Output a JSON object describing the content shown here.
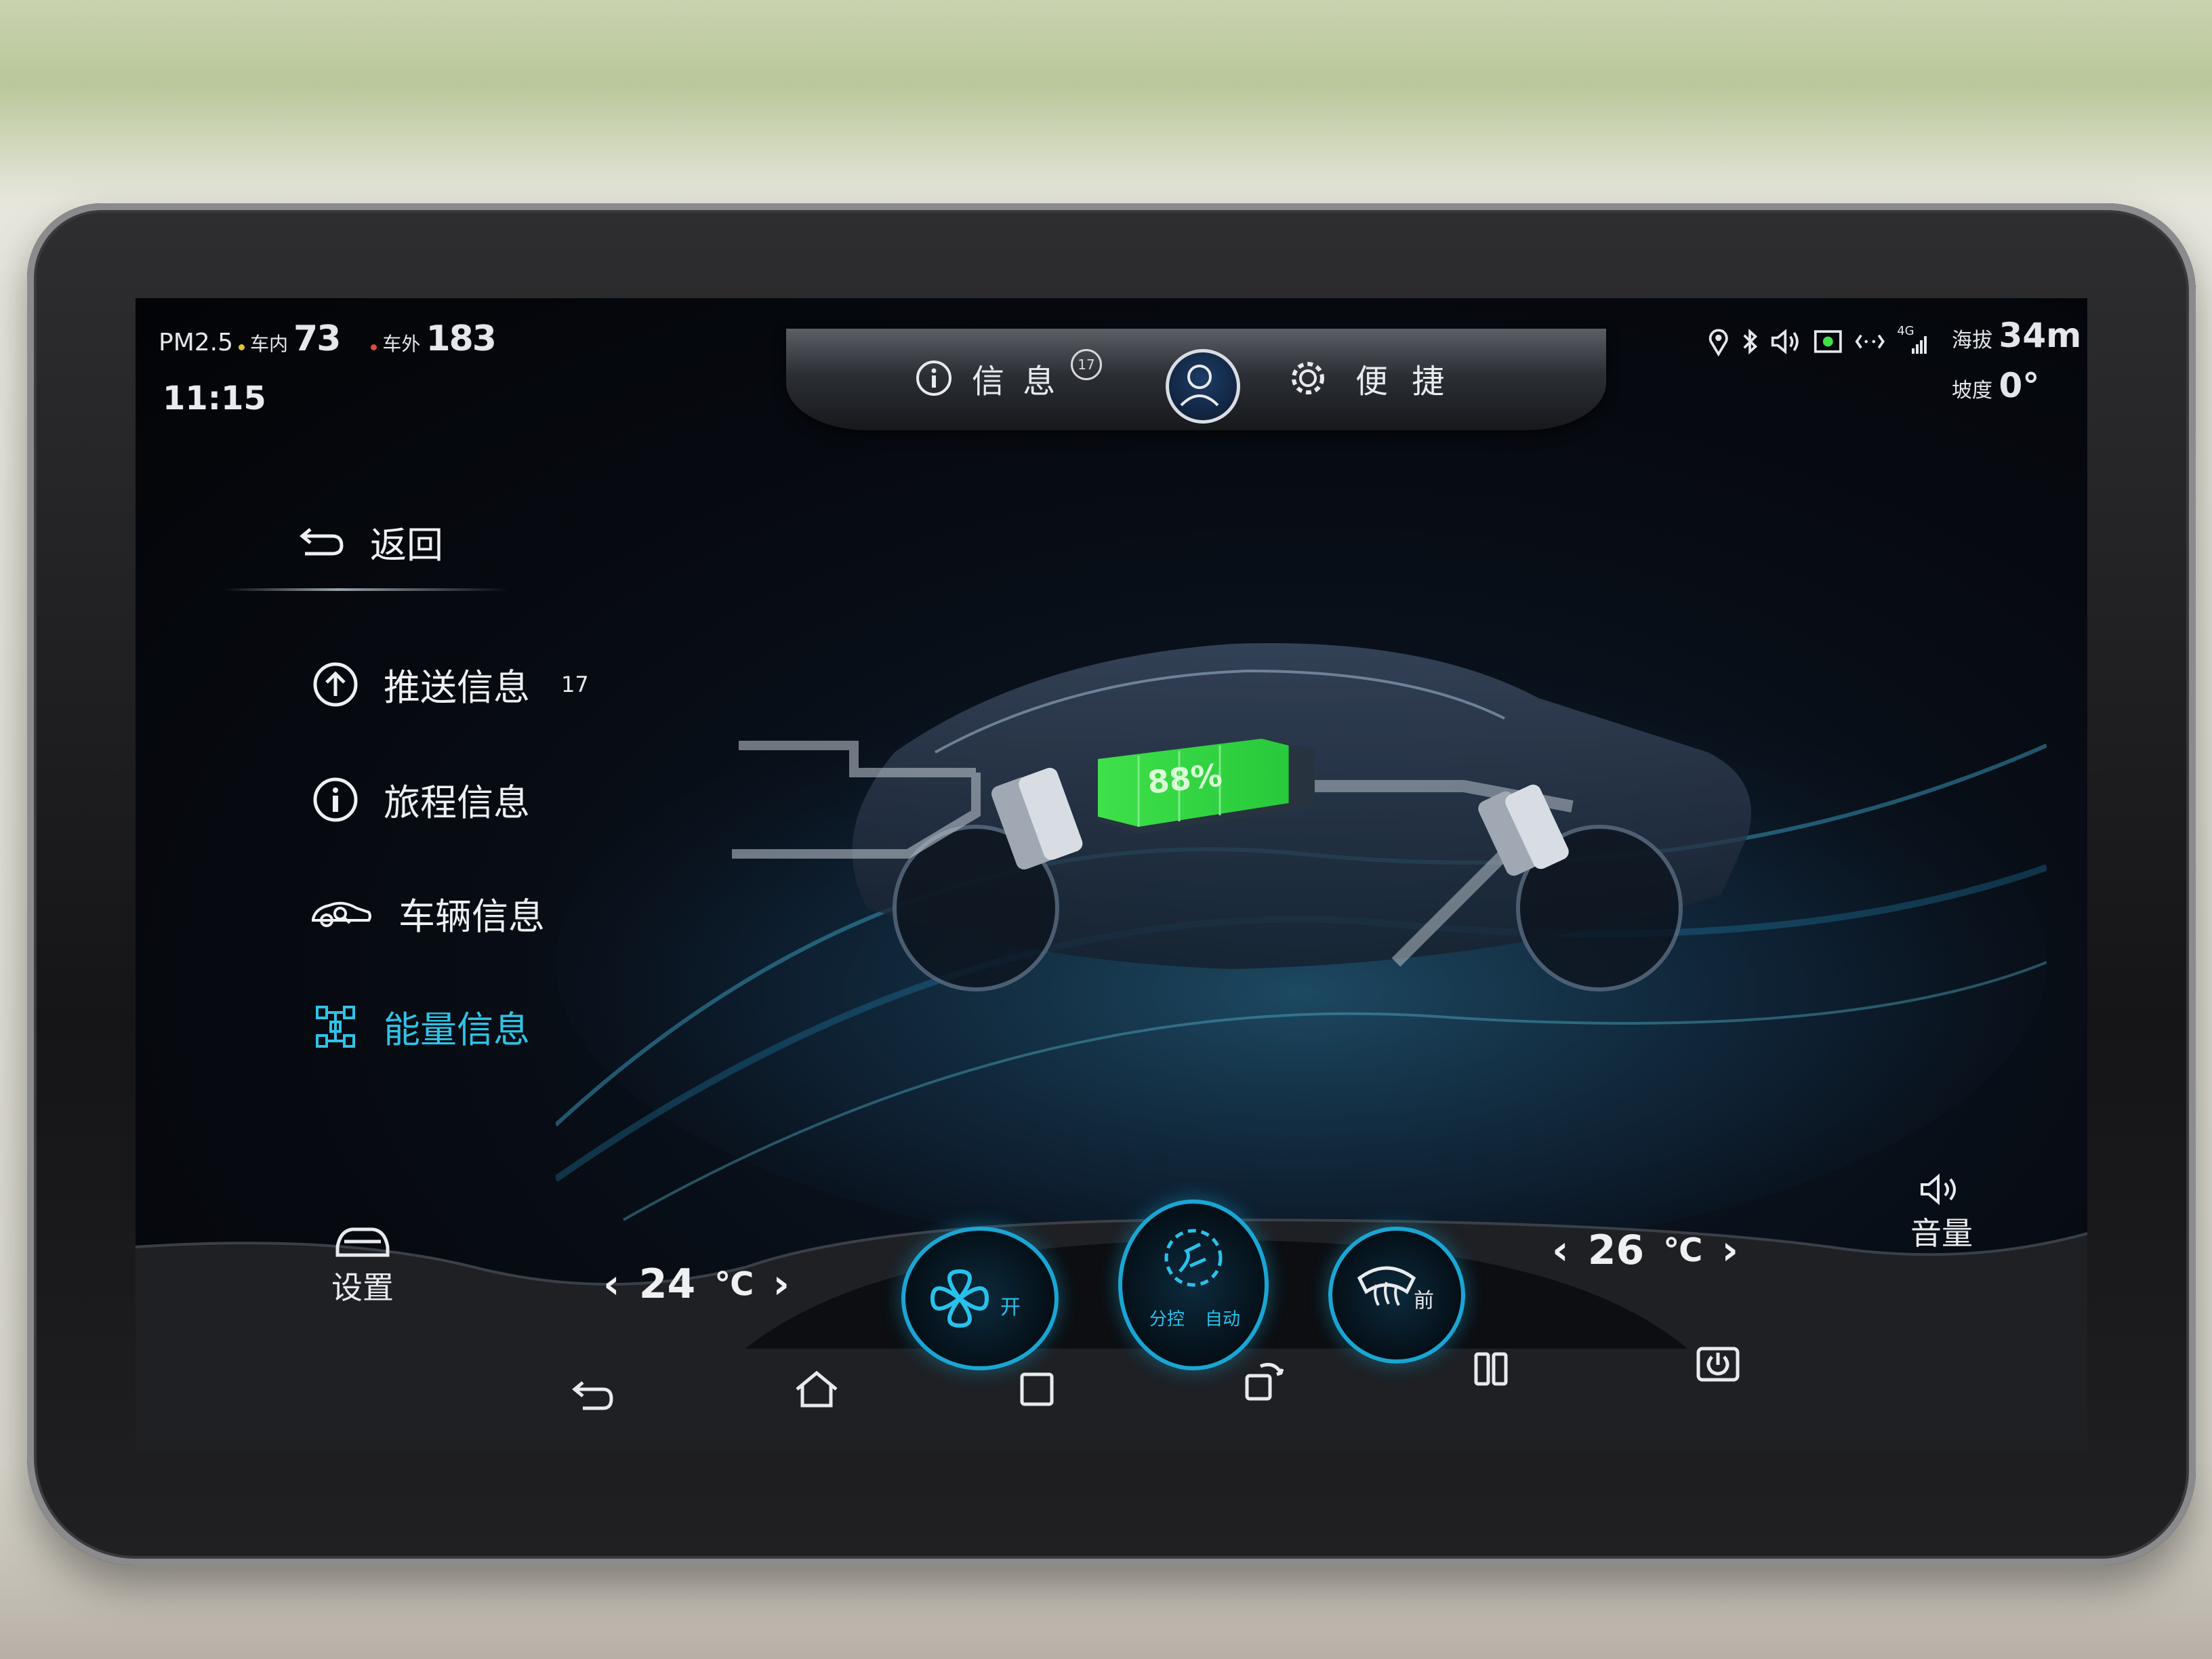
{
  "status": {
    "pm_label": "PM2.5",
    "inside_label": "车内",
    "inside_value": "73",
    "outside_label": "车外",
    "outside_value": "183",
    "time": "11:15",
    "network": "4G",
    "altitude_label": "海拔",
    "altitude_value": "34m",
    "slope_label": "坡度",
    "slope_value": "0°"
  },
  "top_nav": {
    "info_label": "信 息",
    "info_badge": "17",
    "shortcut_label": "便 捷"
  },
  "menu": {
    "back_label": "返回",
    "items": [
      {
        "label": "推送信息",
        "badge": "17",
        "icon": "upload-circle-icon"
      },
      {
        "label": "旅程信息",
        "icon": "info-circle-icon"
      },
      {
        "label": "车辆信息",
        "icon": "car-inspect-icon"
      },
      {
        "label": "能量信息",
        "icon": "powertrain-icon",
        "active": true
      }
    ]
  },
  "energy": {
    "battery_percent": "88%",
    "battery_level": 0.88
  },
  "climate": {
    "settings_label": "设置",
    "left_temp": "24",
    "right_temp": "26",
    "temp_unit": "℃",
    "fan_label": "开",
    "zone_label": "分控",
    "auto_label": "自动",
    "defrost_label": "前",
    "volume_label": "音量"
  },
  "colors": {
    "accent": "#2ec4e8",
    "battery_green": "#3fe04a",
    "text": "#e9ecef"
  }
}
